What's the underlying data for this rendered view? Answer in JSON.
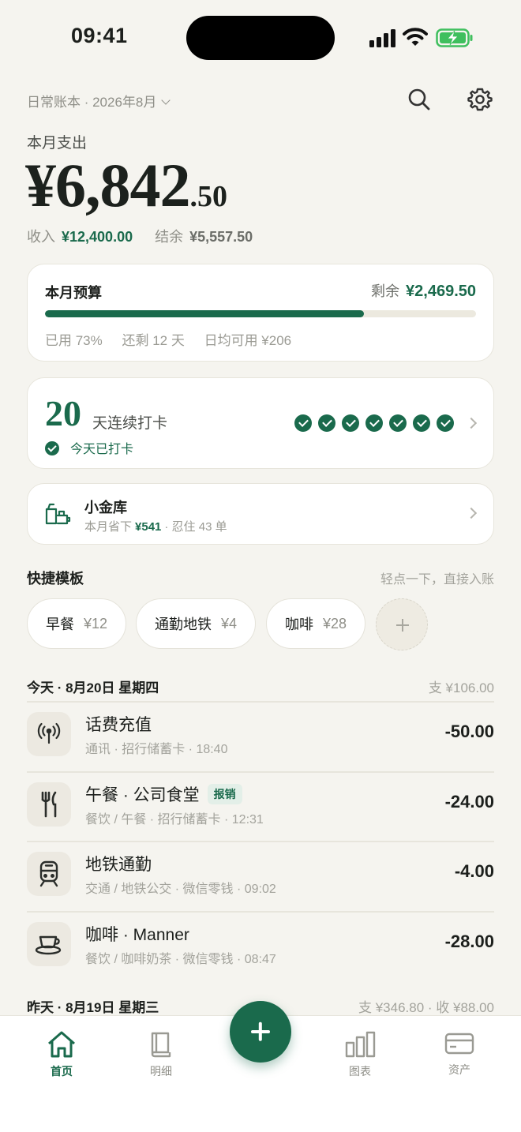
{
  "status": {
    "time": "09:41"
  },
  "header": {
    "book": "日常账本 · 2026年8月",
    "search_icon": "search-icon",
    "settings_icon": "gear-icon"
  },
  "summary": {
    "label": "本月支出",
    "amount_main": "¥6,842",
    "amount_cents": ".50",
    "income_label": "收入",
    "income_value": "¥12,400.00",
    "balance_label": "结余",
    "balance_value": "¥5,557.50"
  },
  "budget": {
    "title": "本月预算",
    "remain_label": "剩余",
    "remain_value": "¥2,469.50",
    "used_fraction": 0.74,
    "used": "已用 73%",
    "days_left": "还剩 12 天",
    "daily": "日均可用 ¥206"
  },
  "streak": {
    "days": "20",
    "label": "天连续打卡",
    "today": "今天已打卡",
    "checked_days": 7
  },
  "vault": {
    "name": "小金库",
    "sub_prefix": "本月省下",
    "saved": "¥541",
    "sub_suffix": "· 忍住 43 单"
  },
  "templates": {
    "title": "快捷模板",
    "hint": "轻点一下，直接入账",
    "items": [
      {
        "name": "早餐",
        "price": "¥12"
      },
      {
        "name": "通勤地铁",
        "price": "¥4"
      },
      {
        "name": "咖啡",
        "price": "¥28"
      }
    ]
  },
  "today": {
    "date": "今天 · 8月20日 星期四",
    "total": "支 ¥106.00",
    "items": [
      {
        "name": "话费充值",
        "tag": "",
        "meta": "通讯 · 招行储蓄卡 · 18:40",
        "amount": "-50.00",
        "icon": "signal-tower-icon"
      },
      {
        "name": "午餐 · 公司食堂",
        "tag": "报销",
        "meta": "餐饮 / 午餐 · 招行储蓄卡 · 12:31",
        "amount": "-24.00",
        "icon": "fork-knife-icon"
      },
      {
        "name": "地铁通勤",
        "tag": "",
        "meta": "交通 / 地铁公交 · 微信零钱 · 09:02",
        "amount": "-4.00",
        "icon": "metro-icon"
      },
      {
        "name": "咖啡 · Manner",
        "tag": "",
        "meta": "餐饮 / 咖啡奶茶 · 微信零钱 · 08:47",
        "amount": "-28.00",
        "icon": "coffee-cup-icon"
      }
    ]
  },
  "yesterday": {
    "date": "昨天 · 8月19日 星期三",
    "total": "支 ¥346.80 · 收 ¥88.00"
  },
  "tabs": [
    {
      "label": "首页",
      "icon": "home-icon"
    },
    {
      "label": "明细",
      "icon": "book-icon"
    },
    {
      "label": "图表",
      "icon": "bar-chart-icon"
    },
    {
      "label": "资产",
      "icon": "card-icon"
    }
  ],
  "colors": {
    "accent": "#1a6a4c",
    "background": "#f5f4ef"
  }
}
